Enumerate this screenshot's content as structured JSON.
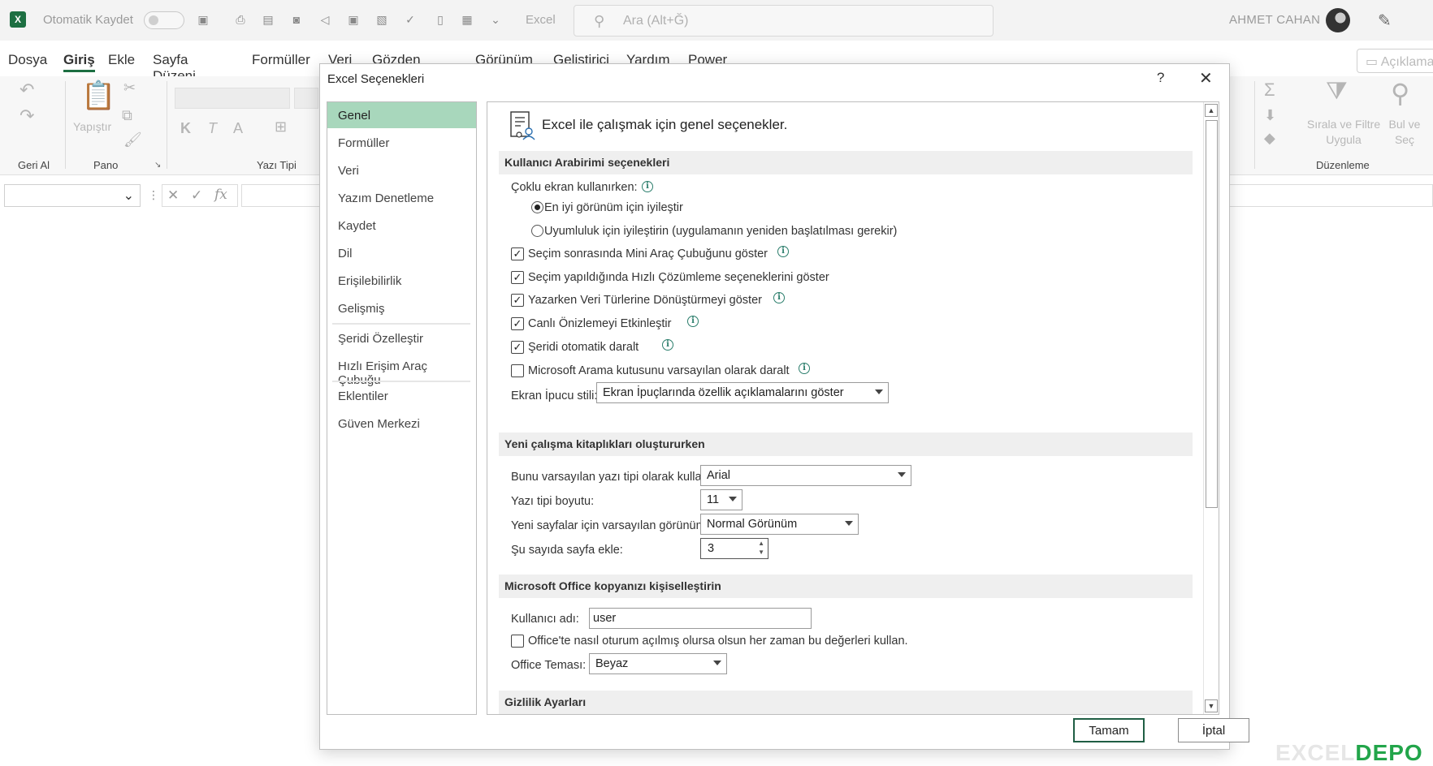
{
  "titlebar": {
    "autosave_label": "Otomatik Kaydet",
    "app_name": "Excel",
    "search_placeholder": "Ara (Alt+Ğ)",
    "user_name": "AHMET CAHAN"
  },
  "menu": {
    "tabs": [
      "Dosya",
      "Giriş",
      "Ekle",
      "Sayfa Düzeni",
      "Formüller",
      "Veri",
      "Gözden Geçir",
      "Görünüm",
      "Geliştirici",
      "Yardım",
      "Power Pivot"
    ],
    "active": "Giriş",
    "comments_label": "Açıklama"
  },
  "ribbon": {
    "groups": {
      "undo": "Geri Al",
      "clipboard": "Pano",
      "font": "Yazı Tipi",
      "editing": "Düzenleme"
    },
    "paste_label": "Yapıştır",
    "sort_filter_label": "Sırala ve Filtre Uygula",
    "find_select_label": "Bul ve Seç",
    "bold_glyph": "K",
    "italic_glyph": "T",
    "fontcolor_glyph": "A"
  },
  "formula": {
    "fx_label": "fx"
  },
  "dialog": {
    "title": "Excel Seçenekleri",
    "help": "?",
    "close": "✕",
    "nav": {
      "items": [
        "Genel",
        "Formüller",
        "Veri",
        "Yazım Denetleme",
        "Kaydet",
        "Dil",
        "Erişilebilirlik",
        "Gelişmiş",
        "Şeridi Özelleştir",
        "Hızlı Erişim Araç Çubuğu",
        "Eklentiler",
        "Güven Merkezi"
      ],
      "active": "Genel"
    },
    "intro": "Excel ile çalışmak için genel seçenekler.",
    "sections": {
      "ui": "Kullanıcı Arabirimi seçenekleri",
      "new_workbook": "Yeni çalışma kitaplıkları oluştururken",
      "personalize": "Microsoft Office kopyanızı kişiselleştirin",
      "privacy": "Gizlilik Ayarları"
    },
    "ui": {
      "multi_screen_label": "Çoklu ekran kullanırken:",
      "radio_best": "En iyi görünüm için iyileştir",
      "radio_compat": "Uyumluluk için iyileştirin (uygulamanın yeniden başlatılması gerekir)",
      "radio_selected": "best",
      "checks": [
        {
          "label": "Seçim sonrasında Mini Araç Çubuğunu göster",
          "checked": true,
          "info": true
        },
        {
          "label": "Seçim yapıldığında Hızlı Çözümleme seçeneklerini göster",
          "checked": true,
          "info": false
        },
        {
          "label": "Yazarken Veri Türlerine Dönüştürmeyi göster",
          "checked": true,
          "info": true
        },
        {
          "label": "Canlı Önizlemeyi Etkinleştir",
          "checked": true,
          "info": true
        },
        {
          "label": "Şeridi otomatik daralt",
          "checked": true,
          "info": true
        },
        {
          "label": "Microsoft Arama kutusunu varsayılan olarak daralt",
          "checked": false,
          "info": true
        }
      ],
      "tooltip_label": "Ekran İpucu stili:",
      "tooltip_value": "Ekran İpuçlarında özellik açıklamalarını göster"
    },
    "new_workbook": {
      "font_label": "Bunu varsayılan yazı tipi olarak kullan:",
      "font_value": "Arial",
      "size_label": "Yazı tipi boyutu:",
      "size_value": "11",
      "view_label": "Yeni sayfalar için varsayılan görünüm:",
      "view_value": "Normal Görünüm",
      "sheets_label": "Şu sayıda sayfa ekle:",
      "sheets_value": "3"
    },
    "personalize": {
      "username_label": "Kullanıcı adı:",
      "username_value": "user",
      "always_use_label": "Office'te nasıl oturum açılmış olursa olsun her zaman bu değerleri kullan.",
      "always_use_checked": false,
      "theme_label": "Office Teması:",
      "theme_value": "Beyaz"
    },
    "buttons": {
      "ok": "Tamam",
      "cancel": "İptal"
    }
  },
  "watermark": {
    "part1": "EXCEL",
    "part2": "DEPO"
  },
  "colors": {
    "accent": "#1d6f42",
    "nav_active": "#a8d7bc",
    "info": "#2a7d6b"
  }
}
